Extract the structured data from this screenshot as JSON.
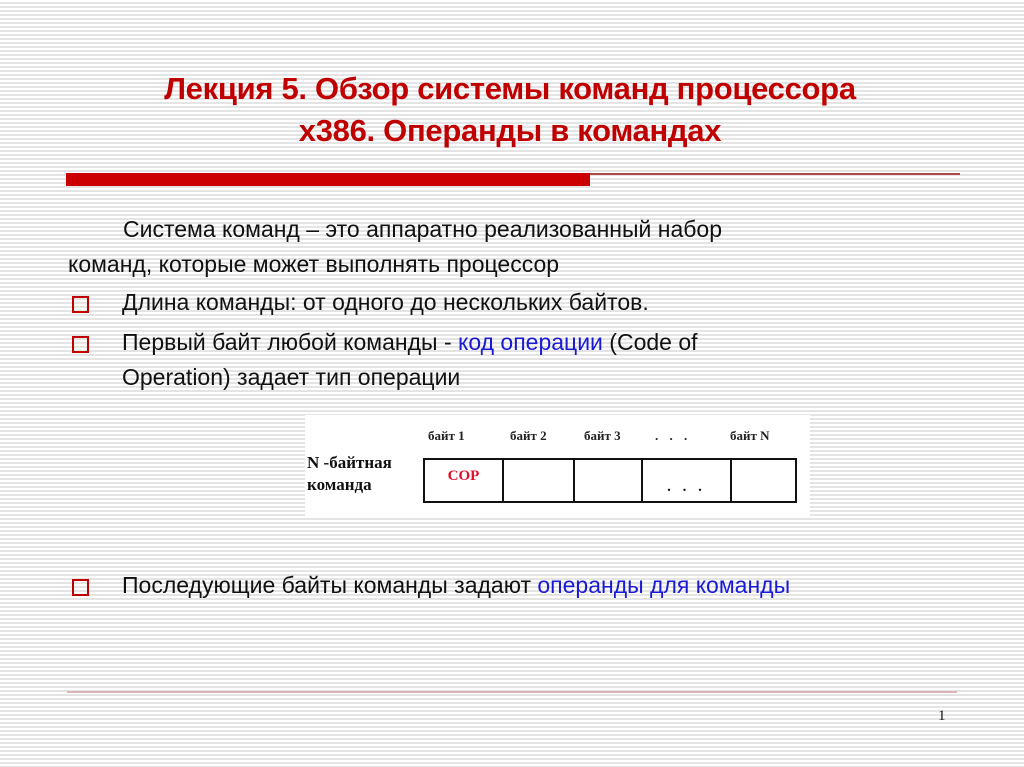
{
  "slide": {
    "title_line1": "Лекция 5.  Обзор системы команд процессора",
    "title_line2": "x386. Операнды в командах",
    "intro_line1": "Система команд –  это аппаратно реализованный набор",
    "intro_line2": "команд, которые может выполнять процессор",
    "bullets": [
      {
        "text": "Длина команды: от одного до нескольких байтов."
      },
      {
        "text_before": "Первый байт любой команды - ",
        "highlight": "код операции",
        "text_after": " (Code of",
        "line2": "Operation)  задает тип операции"
      },
      {
        "text_before": "Последующие байты команды задают ",
        "highlight": "операнды для команды"
      }
    ],
    "diagram": {
      "row_label_line1": "N -байтная",
      "row_label_line2": "команда",
      "headers": [
        "байт 1",
        "байт 2",
        "байт 3",
        ". . .",
        "байт N"
      ],
      "cells": [
        "COP",
        "",
        "",
        ". . .",
        ""
      ]
    },
    "page_number": "1"
  },
  "colors": {
    "title": "#c00000",
    "bullet": "#c00000",
    "highlight": "#1a1ad6",
    "cop": "#e0102a"
  }
}
